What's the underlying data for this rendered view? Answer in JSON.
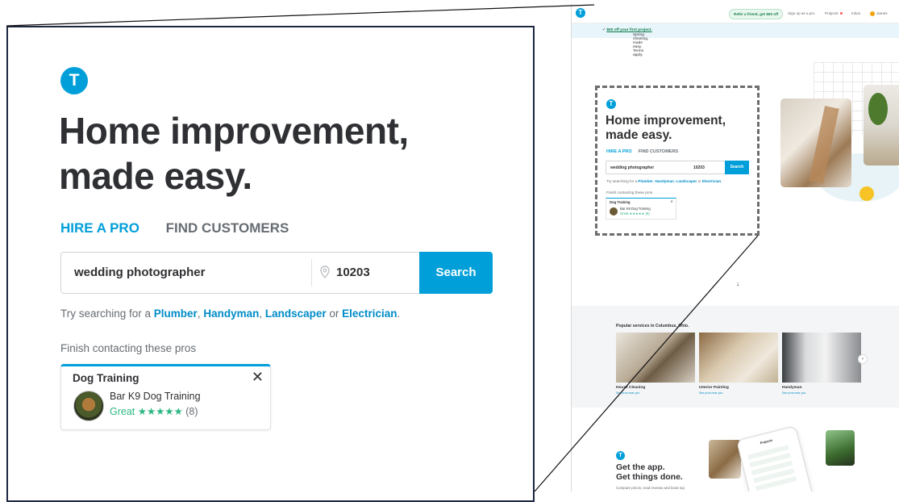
{
  "zoom": {
    "logo_letter": "T",
    "headline_line1": "Home improvement,",
    "headline_line2": "made easy.",
    "tab_hire": "HIRE A PRO",
    "tab_find": "FIND CUSTOMERS",
    "search_query": "wedding photographer",
    "zip": "10203",
    "search_button": "Search",
    "try_prefix": "Try searching for a ",
    "try_links": [
      "Plumber",
      "Handyman",
      "Landscaper",
      "Electrician"
    ],
    "try_sep1": ", ",
    "try_or": " or ",
    "try_end": ".",
    "finish_label": "Finish contacting these pros",
    "card": {
      "title": "Dog Training",
      "close": "✕",
      "pro_name": "Bar K9 Dog Training",
      "rating_word": "Great",
      "stars": "★★★★★",
      "count": "(8)"
    }
  },
  "mini": {
    "nav": {
      "refer": "Refer a friend, get $50 off",
      "signup": "Sign up as a pro",
      "projects": "Projects",
      "inbox": "Inbox",
      "user": "James"
    },
    "banner": {
      "offer": "$50 off your first project.",
      "rest": " Spring cleaning, made easy. Terms apply."
    },
    "headline_line1": "Home improvement,",
    "headline_line2": "made easy.",
    "tab_hire": "HIRE A PRO",
    "tab_find": "FIND CUSTOMERS",
    "search_query": "wedding photographer",
    "zip": "10203",
    "search_button": "Search",
    "try_text_prefix": "Try searching for a ",
    "try_links": [
      "Plumber",
      "Handyman",
      "Landscaper",
      "Electrician"
    ],
    "finish_label": "Finish contacting these pros",
    "card_title": "Dog Training",
    "card_name": "Bar K9 Dog Training",
    "card_rating": "Great ★★★★★ (8)",
    "arrow": "↓",
    "popular_title": "Popular services in Columbus, Ohio.",
    "tiles": [
      {
        "label": "House Cleaning",
        "sub": "See pros near you"
      },
      {
        "label": "Interior Painting",
        "sub": "See pros near you"
      },
      {
        "label": "Handyman",
        "sub": "See pros near you"
      }
    ],
    "app_line1": "Get the app.",
    "app_line2": "Get things done.",
    "app_sub": "Compare prices, read reviews and book top",
    "phone_title": "Projects"
  },
  "colors": {
    "brand_blue": "#009fd9",
    "text_dark": "#2f3033",
    "rating_green": "#2db783"
  }
}
